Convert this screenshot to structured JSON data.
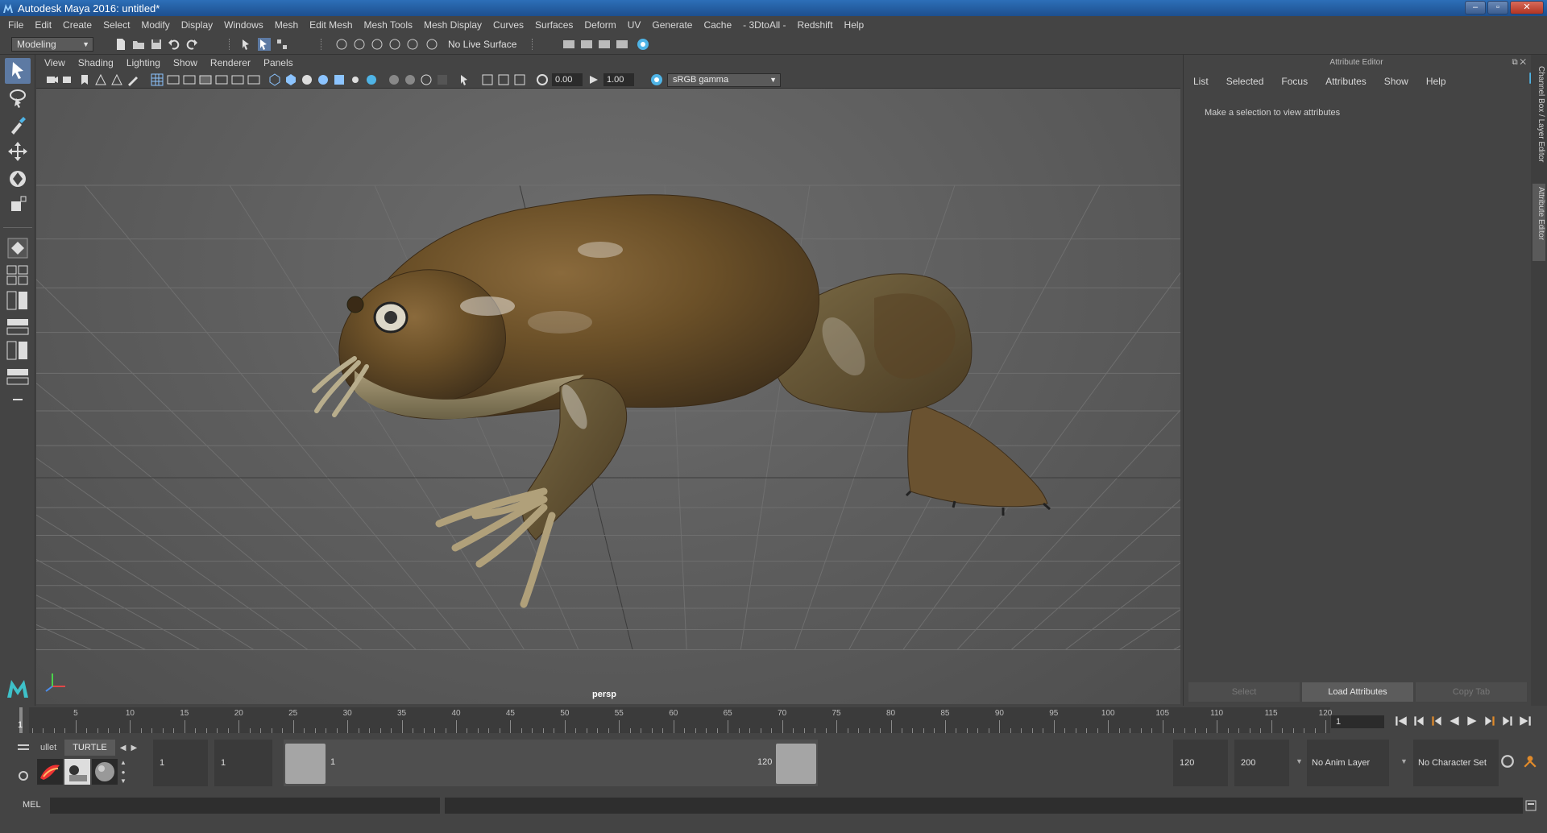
{
  "window": {
    "title": "Autodesk Maya 2016: untitled*"
  },
  "menubar": {
    "items": [
      "File",
      "Edit",
      "Create",
      "Select",
      "Modify",
      "Display",
      "Windows",
      "Mesh",
      "Edit Mesh",
      "Mesh Tools",
      "Mesh Display",
      "Curves",
      "Surfaces",
      "Deform",
      "UV",
      "Generate",
      "Cache",
      "- 3DtoAll -",
      "Redshift",
      "Help"
    ]
  },
  "statusline": {
    "mode": "Modeling",
    "live_surface": "No Live Surface"
  },
  "panel": {
    "menu": [
      "View",
      "Shading",
      "Lighting",
      "Show",
      "Renderer",
      "Panels"
    ],
    "exposure": "0.00",
    "gamma": "1.00",
    "color_space": "sRGB gamma",
    "camera": "persp"
  },
  "attribute_editor": {
    "title": "Attribute Editor",
    "menu": [
      "List",
      "Selected",
      "Focus",
      "Attributes",
      "Show",
      "Help"
    ],
    "message": "Make a selection to view attributes",
    "buttons": [
      "Select",
      "Load Attributes",
      "Copy Tab"
    ]
  },
  "side_tabs": [
    "Channel Box / Layer Editor",
    "Attribute Editor"
  ],
  "timeline": {
    "current_frame": "1",
    "labels": [
      "5",
      "10",
      "15",
      "20",
      "25",
      "30",
      "35",
      "40",
      "45",
      "50",
      "55",
      "60",
      "65",
      "70",
      "75",
      "80",
      "85",
      "90",
      "95",
      "100",
      "105",
      "110",
      "115",
      "120"
    ],
    "frame_field": "1"
  },
  "range": {
    "shelf_tabs": [
      "ullet",
      "TURTLE"
    ],
    "start": "1",
    "playback_start": "1",
    "slider_start": "1",
    "slider_end": "120",
    "playback_end": "120",
    "end": "200",
    "anim_layer": "No Anim Layer",
    "character_set": "No Character Set"
  },
  "mel": {
    "label": "MEL"
  },
  "colors": {
    "selected_tool": "#5d7aa3",
    "viewport_grid": "#6f6f6f"
  },
  "icons": [
    "maya-logo-icon",
    "select-tool-icon",
    "lasso-tool-icon",
    "paint-select-icon",
    "move-tool-icon",
    "rotate-tool-icon",
    "scale-tool-icon",
    "axis-gizmo-icon",
    "play-icon"
  ]
}
